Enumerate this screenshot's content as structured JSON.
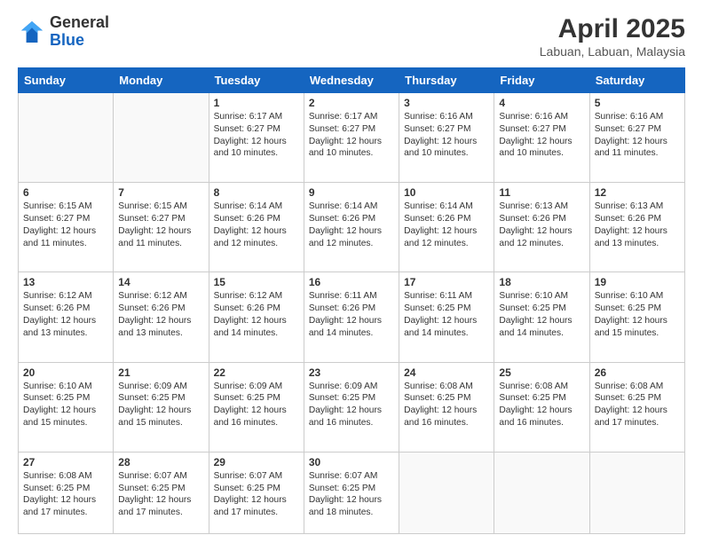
{
  "header": {
    "logo_general": "General",
    "logo_blue": "Blue",
    "title": "April 2025",
    "subtitle": "Labuan, Labuan, Malaysia"
  },
  "days_of_week": [
    "Sunday",
    "Monday",
    "Tuesday",
    "Wednesday",
    "Thursday",
    "Friday",
    "Saturday"
  ],
  "weeks": [
    [
      {
        "day": "",
        "sunrise": "",
        "sunset": "",
        "daylight": ""
      },
      {
        "day": "",
        "sunrise": "",
        "sunset": "",
        "daylight": ""
      },
      {
        "day": "1",
        "sunrise": "Sunrise: 6:17 AM",
        "sunset": "Sunset: 6:27 PM",
        "daylight": "Daylight: 12 hours and 10 minutes."
      },
      {
        "day": "2",
        "sunrise": "Sunrise: 6:17 AM",
        "sunset": "Sunset: 6:27 PM",
        "daylight": "Daylight: 12 hours and 10 minutes."
      },
      {
        "day": "3",
        "sunrise": "Sunrise: 6:16 AM",
        "sunset": "Sunset: 6:27 PM",
        "daylight": "Daylight: 12 hours and 10 minutes."
      },
      {
        "day": "4",
        "sunrise": "Sunrise: 6:16 AM",
        "sunset": "Sunset: 6:27 PM",
        "daylight": "Daylight: 12 hours and 10 minutes."
      },
      {
        "day": "5",
        "sunrise": "Sunrise: 6:16 AM",
        "sunset": "Sunset: 6:27 PM",
        "daylight": "Daylight: 12 hours and 11 minutes."
      }
    ],
    [
      {
        "day": "6",
        "sunrise": "Sunrise: 6:15 AM",
        "sunset": "Sunset: 6:27 PM",
        "daylight": "Daylight: 12 hours and 11 minutes."
      },
      {
        "day": "7",
        "sunrise": "Sunrise: 6:15 AM",
        "sunset": "Sunset: 6:27 PM",
        "daylight": "Daylight: 12 hours and 11 minutes."
      },
      {
        "day": "8",
        "sunrise": "Sunrise: 6:14 AM",
        "sunset": "Sunset: 6:26 PM",
        "daylight": "Daylight: 12 hours and 12 minutes."
      },
      {
        "day": "9",
        "sunrise": "Sunrise: 6:14 AM",
        "sunset": "Sunset: 6:26 PM",
        "daylight": "Daylight: 12 hours and 12 minutes."
      },
      {
        "day": "10",
        "sunrise": "Sunrise: 6:14 AM",
        "sunset": "Sunset: 6:26 PM",
        "daylight": "Daylight: 12 hours and 12 minutes."
      },
      {
        "day": "11",
        "sunrise": "Sunrise: 6:13 AM",
        "sunset": "Sunset: 6:26 PM",
        "daylight": "Daylight: 12 hours and 12 minutes."
      },
      {
        "day": "12",
        "sunrise": "Sunrise: 6:13 AM",
        "sunset": "Sunset: 6:26 PM",
        "daylight": "Daylight: 12 hours and 13 minutes."
      }
    ],
    [
      {
        "day": "13",
        "sunrise": "Sunrise: 6:12 AM",
        "sunset": "Sunset: 6:26 PM",
        "daylight": "Daylight: 12 hours and 13 minutes."
      },
      {
        "day": "14",
        "sunrise": "Sunrise: 6:12 AM",
        "sunset": "Sunset: 6:26 PM",
        "daylight": "Daylight: 12 hours and 13 minutes."
      },
      {
        "day": "15",
        "sunrise": "Sunrise: 6:12 AM",
        "sunset": "Sunset: 6:26 PM",
        "daylight": "Daylight: 12 hours and 14 minutes."
      },
      {
        "day": "16",
        "sunrise": "Sunrise: 6:11 AM",
        "sunset": "Sunset: 6:26 PM",
        "daylight": "Daylight: 12 hours and 14 minutes."
      },
      {
        "day": "17",
        "sunrise": "Sunrise: 6:11 AM",
        "sunset": "Sunset: 6:25 PM",
        "daylight": "Daylight: 12 hours and 14 minutes."
      },
      {
        "day": "18",
        "sunrise": "Sunrise: 6:10 AM",
        "sunset": "Sunset: 6:25 PM",
        "daylight": "Daylight: 12 hours and 14 minutes."
      },
      {
        "day": "19",
        "sunrise": "Sunrise: 6:10 AM",
        "sunset": "Sunset: 6:25 PM",
        "daylight": "Daylight: 12 hours and 15 minutes."
      }
    ],
    [
      {
        "day": "20",
        "sunrise": "Sunrise: 6:10 AM",
        "sunset": "Sunset: 6:25 PM",
        "daylight": "Daylight: 12 hours and 15 minutes."
      },
      {
        "day": "21",
        "sunrise": "Sunrise: 6:09 AM",
        "sunset": "Sunset: 6:25 PM",
        "daylight": "Daylight: 12 hours and 15 minutes."
      },
      {
        "day": "22",
        "sunrise": "Sunrise: 6:09 AM",
        "sunset": "Sunset: 6:25 PM",
        "daylight": "Daylight: 12 hours and 16 minutes."
      },
      {
        "day": "23",
        "sunrise": "Sunrise: 6:09 AM",
        "sunset": "Sunset: 6:25 PM",
        "daylight": "Daylight: 12 hours and 16 minutes."
      },
      {
        "day": "24",
        "sunrise": "Sunrise: 6:08 AM",
        "sunset": "Sunset: 6:25 PM",
        "daylight": "Daylight: 12 hours and 16 minutes."
      },
      {
        "day": "25",
        "sunrise": "Sunrise: 6:08 AM",
        "sunset": "Sunset: 6:25 PM",
        "daylight": "Daylight: 12 hours and 16 minutes."
      },
      {
        "day": "26",
        "sunrise": "Sunrise: 6:08 AM",
        "sunset": "Sunset: 6:25 PM",
        "daylight": "Daylight: 12 hours and 17 minutes."
      }
    ],
    [
      {
        "day": "27",
        "sunrise": "Sunrise: 6:08 AM",
        "sunset": "Sunset: 6:25 PM",
        "daylight": "Daylight: 12 hours and 17 minutes."
      },
      {
        "day": "28",
        "sunrise": "Sunrise: 6:07 AM",
        "sunset": "Sunset: 6:25 PM",
        "daylight": "Daylight: 12 hours and 17 minutes."
      },
      {
        "day": "29",
        "sunrise": "Sunrise: 6:07 AM",
        "sunset": "Sunset: 6:25 PM",
        "daylight": "Daylight: 12 hours and 17 minutes."
      },
      {
        "day": "30",
        "sunrise": "Sunrise: 6:07 AM",
        "sunset": "Sunset: 6:25 PM",
        "daylight": "Daylight: 12 hours and 18 minutes."
      },
      {
        "day": "",
        "sunrise": "",
        "sunset": "",
        "daylight": ""
      },
      {
        "day": "",
        "sunrise": "",
        "sunset": "",
        "daylight": ""
      },
      {
        "day": "",
        "sunrise": "",
        "sunset": "",
        "daylight": ""
      }
    ]
  ]
}
